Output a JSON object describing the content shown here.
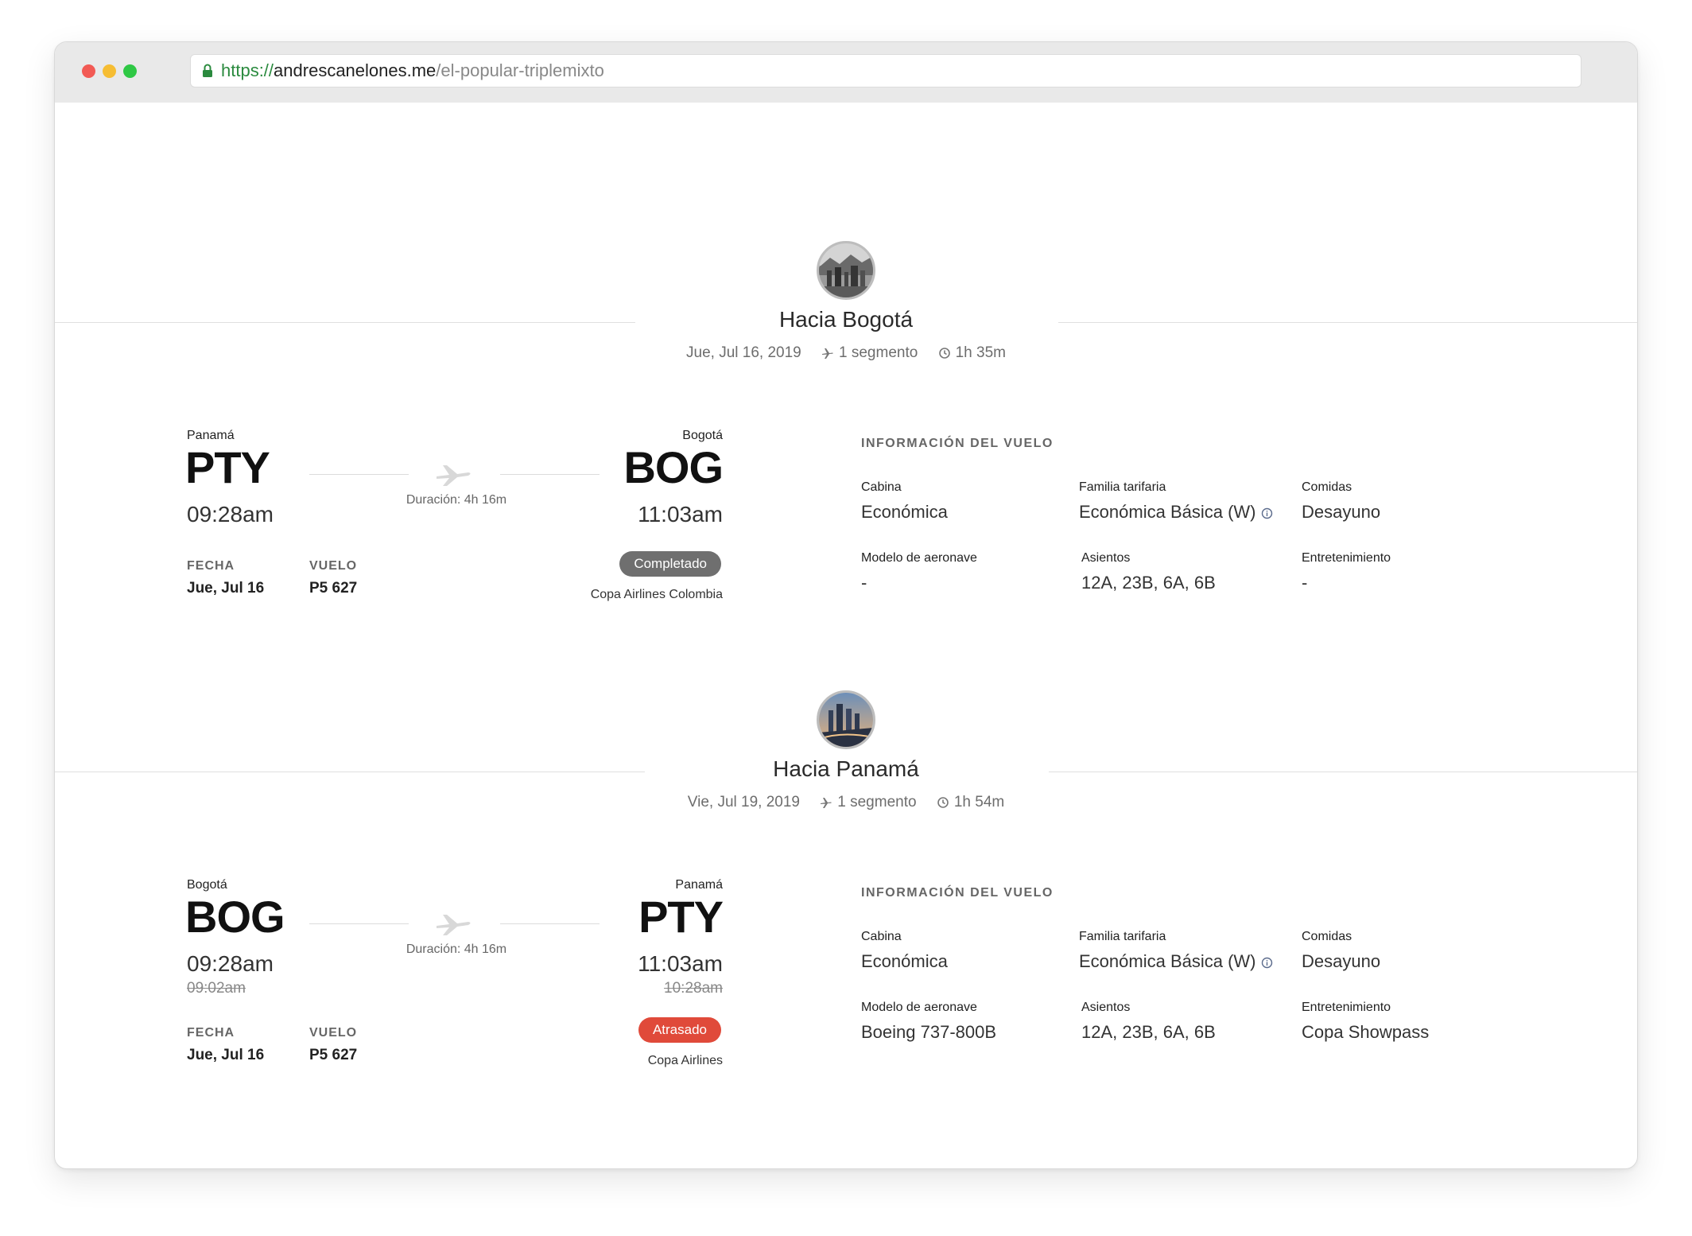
{
  "browser": {
    "url_scheme": "https://",
    "url_host": "andrescanelones.me",
    "url_path": "/el-popular-triplemixto"
  },
  "trips": [
    {
      "title": "Hacia Bogotá",
      "date": "Jue, Jul 16, 2019",
      "segments": "1 segmento",
      "total_duration": "1h 35m",
      "origin_city": "Panamá",
      "origin_code": "PTY",
      "origin_time": "09:28am",
      "origin_time_old": "",
      "destination_city": "Bogotá",
      "destination_code": "BOG",
      "destination_time": "11:03am",
      "destination_time_old": "",
      "flight_duration": "Duración: 4h 16m",
      "date_label": "FECHA",
      "date_value": "Jue, Jul 16",
      "flight_label": "VUELO",
      "flight_value": "P5 627",
      "status": "Completado",
      "status_color": "#6f6f6f",
      "airline": "Copa Airlines Colombia",
      "info": {
        "heading": "INFORMACIÓN DEL VUELO",
        "cabin_label": "Cabina",
        "cabin_value": "Económica",
        "fare_label": "Familia tarifaria",
        "fare_value": "Económica Básica (W)",
        "meals_label": "Comidas",
        "meals_value": "Desayuno",
        "aircraft_label": "Modelo de aeronave",
        "aircraft_value": "-",
        "seats_label": "Asientos",
        "seats_value": "12A, 23B, 6A, 6B",
        "entertainment_label": "Entretenimiento",
        "entertainment_value": "-"
      }
    },
    {
      "title": "Hacia Panamá",
      "date": "Vie, Jul 19, 2019",
      "segments": "1 segmento",
      "total_duration": "1h 54m",
      "origin_city": "Bogotá",
      "origin_code": "BOG",
      "origin_time": "09:28am",
      "origin_time_old": "09:02am",
      "destination_city": "Panamá",
      "destination_code": "PTY",
      "destination_time": "11:03am",
      "destination_time_old": "10:28am",
      "flight_duration": "Duración: 4h 16m",
      "date_label": "FECHA",
      "date_value": "Jue, Jul 16",
      "flight_label": "VUELO",
      "flight_value": "P5 627",
      "status": "Atrasado",
      "status_color": "#e04a3a",
      "airline": "Copa Airlines",
      "info": {
        "heading": "INFORMACIÓN DEL VUELO",
        "cabin_label": "Cabina",
        "cabin_value": "Económica",
        "fare_label": "Familia tarifaria",
        "fare_value": "Económica Básica (W)",
        "meals_label": "Comidas",
        "meals_value": "Desayuno",
        "aircraft_label": "Modelo de aeronave",
        "aircraft_value": "Boeing 737-800B",
        "seats_label": "Asientos",
        "seats_value": "12A, 23B, 6A, 6B",
        "entertainment_label": "Entretenimiento",
        "entertainment_value": "Copa Showpass"
      }
    }
  ]
}
